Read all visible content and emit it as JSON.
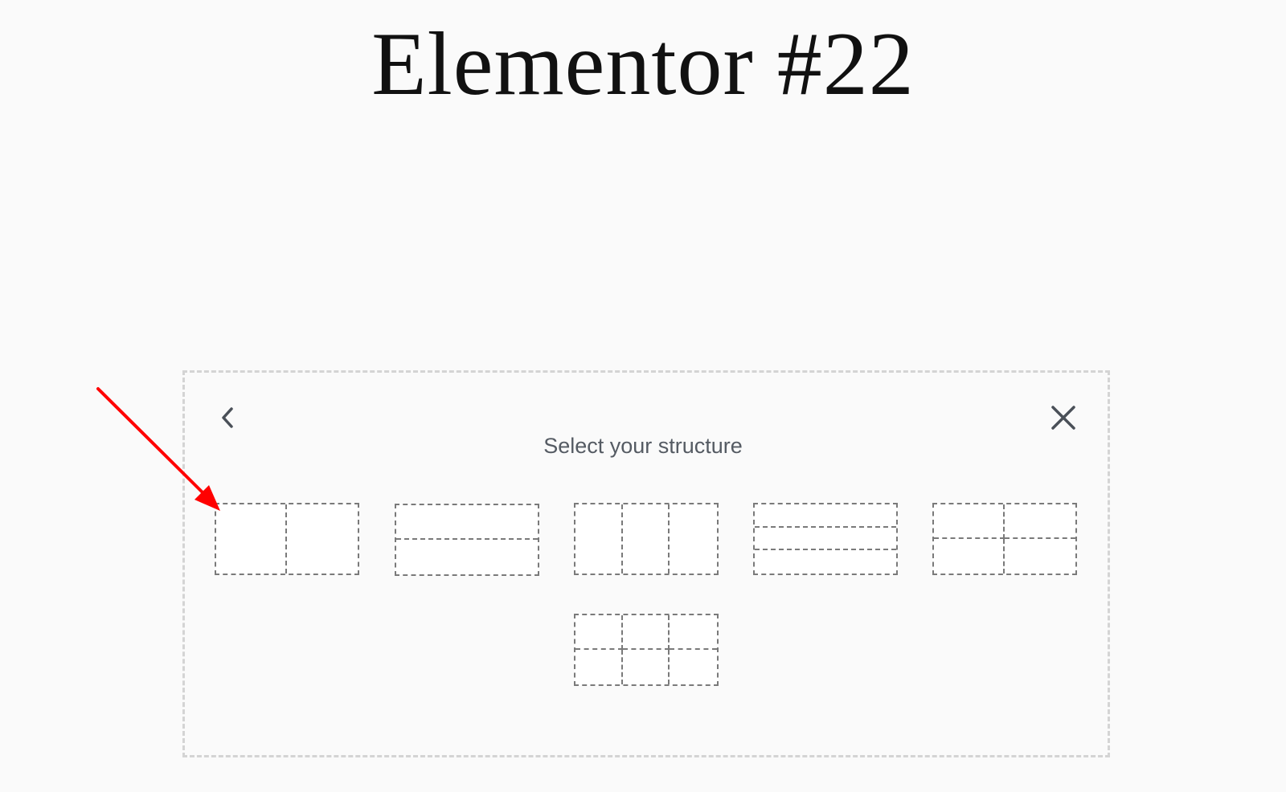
{
  "page": {
    "title": "Elementor #22"
  },
  "structure_panel": {
    "heading": "Select your structure",
    "back_icon": "chevron-left-icon",
    "close_icon": "close-icon",
    "presets": [
      {
        "layout": "two-columns"
      },
      {
        "layout": "two-rows"
      },
      {
        "layout": "three-columns"
      },
      {
        "layout": "three-rows"
      },
      {
        "layout": "two-by-two-grid"
      },
      {
        "layout": "three-by-two-grid"
      }
    ]
  },
  "annotation": {
    "arrow_color": "#ff0000"
  },
  "colors": {
    "background": "#fafafa",
    "title_text": "#111111",
    "heading_text": "#555b63",
    "icon": "#4a5058",
    "preset_border": "#7a7a7a",
    "panel_border": "#d4d4d4"
  }
}
